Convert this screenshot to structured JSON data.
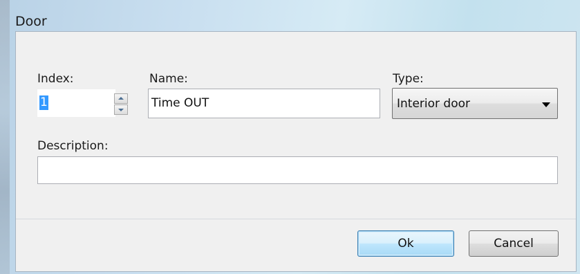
{
  "window": {
    "title": "Door"
  },
  "form": {
    "index_label": "Index:",
    "index_value": "1",
    "name_label": "Name:",
    "name_value": "Time OUT",
    "type_label": "Type:",
    "type_value": "Interior door",
    "description_label": "Description:",
    "description_value": ""
  },
  "buttons": {
    "ok_label": "Ok",
    "cancel_label": "Cancel"
  },
  "icons": {
    "spin_up": "spin-up-arrow",
    "spin_down": "spin-down-arrow",
    "dropdown": "chevron-down"
  },
  "colors": {
    "selection": "#3399ff",
    "default_button_border": "#3c7fb1"
  }
}
